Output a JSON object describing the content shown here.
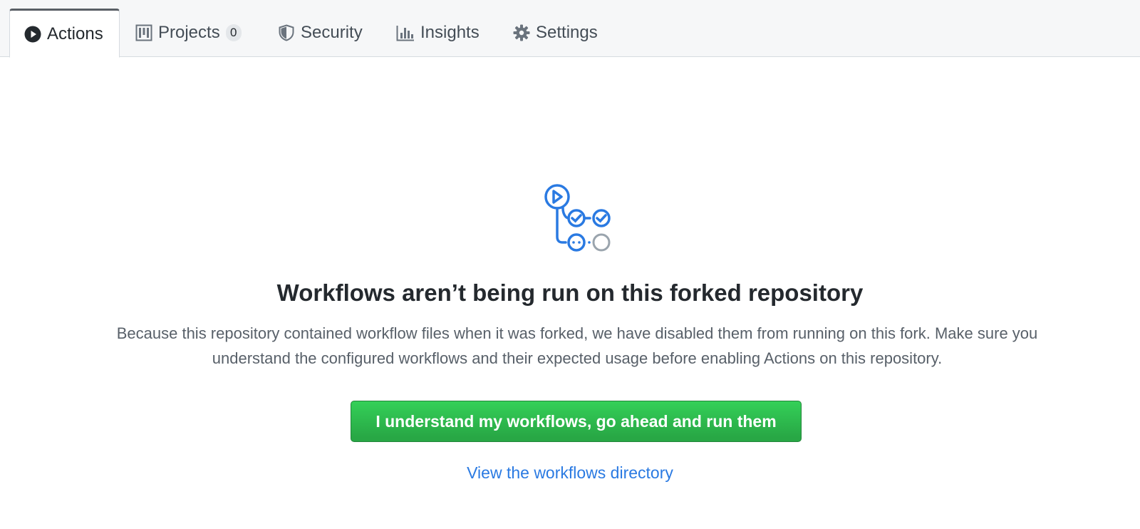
{
  "tabs": [
    {
      "label": "Actions",
      "icon": "play-circle-icon",
      "selected": true
    },
    {
      "label": "Projects",
      "icon": "project-board-icon",
      "counter": "0"
    },
    {
      "label": "Security",
      "icon": "shield-icon"
    },
    {
      "label": "Insights",
      "icon": "graph-icon"
    },
    {
      "label": "Settings",
      "icon": "gear-icon"
    }
  ],
  "blankslate": {
    "icon": "workflow-graph-icon",
    "heading": "Workflows aren’t being run on this forked repository",
    "description": "Because this repository contained workflow files when it was forked, we have disabled them from running on this fork. Make sure you understand the configured workflows and their expected usage before enabling Actions on this repository.",
    "primary_button": "I understand my workflows, go ahead and run them",
    "link": "View the workflows directory"
  },
  "colors": {
    "accent_blue": "#2a7ae2",
    "button_green": "#2ea44f",
    "heading_text": "#24292e",
    "muted_text": "#586069"
  }
}
